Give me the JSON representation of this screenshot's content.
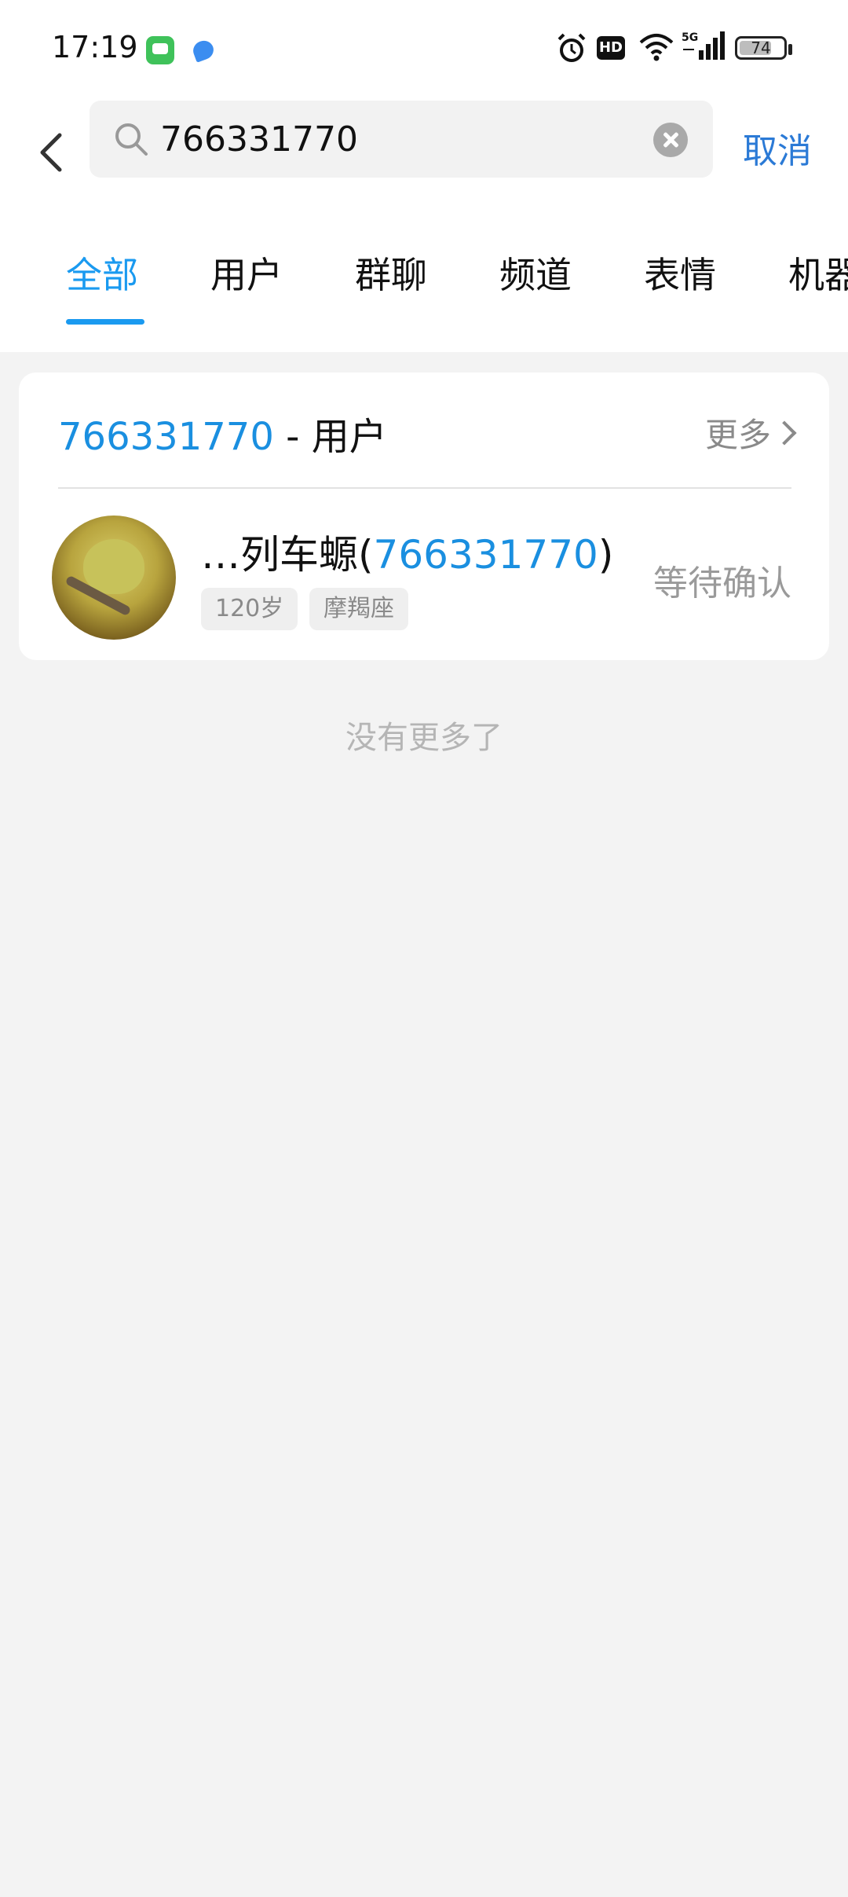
{
  "status_bar": {
    "time": "17:19",
    "hd": "HD",
    "network": "5G",
    "battery": "74",
    "battery_level": 0.74
  },
  "search": {
    "query": "766331770",
    "cancel": "取消"
  },
  "tabs": [
    "全部",
    "用户",
    "群聊",
    "频道",
    "表情",
    "机器"
  ],
  "active_tab": 0,
  "section": {
    "title_query": "766331770",
    "title_suffix": " - 用户",
    "more": "更多"
  },
  "result": {
    "name_prefix": "…列车螈(",
    "name_id": "766331770",
    "name_suffix": ")",
    "tags": [
      "120岁",
      "摩羯座"
    ],
    "status": "等待确认"
  },
  "footer": {
    "no_more": "没有更多了"
  },
  "colors": {
    "accent": "#1a9af0",
    "cancel": "#2b7ad6",
    "background": "#f3f3f3"
  },
  "icons": [
    "back-arrow-icon",
    "search-icon",
    "clear-icon",
    "chevron-right-icon",
    "alarm-icon",
    "wifi-icon",
    "signal-icon",
    "battery-icon"
  ]
}
